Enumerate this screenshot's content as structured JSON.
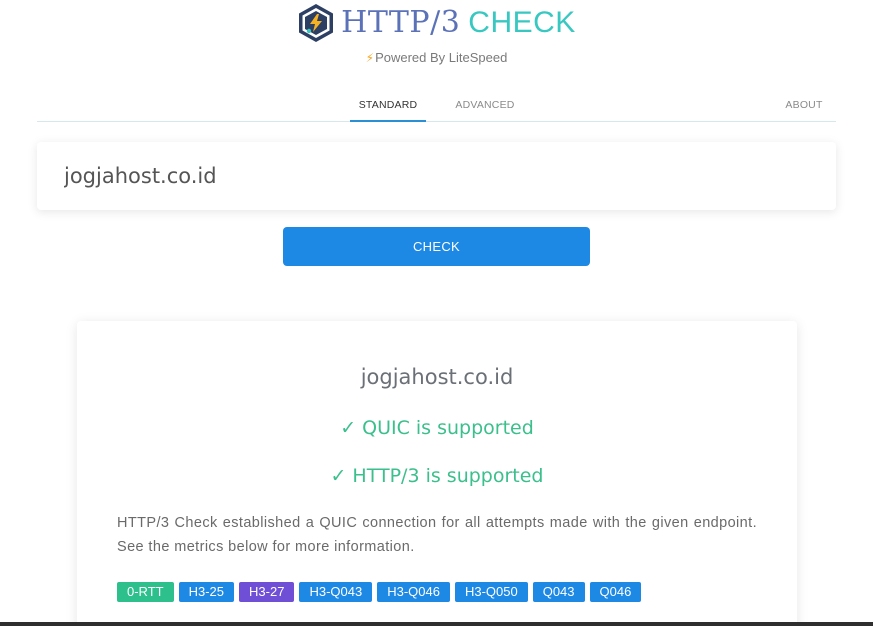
{
  "brand": {
    "title_http": "HTTP/3",
    "title_check": "CHECK",
    "powered_by": "Powered By LiteSpeed",
    "logo_icon": "litespeed-hexagon-logo-icon",
    "bolt_icon": "lightning-bolt-icon",
    "colors": {
      "http": "#5b72b8",
      "check": "#38c7c1",
      "bolt": "#f5a623"
    }
  },
  "tabs": [
    {
      "label": "STANDARD",
      "active": true
    },
    {
      "label": "ADVANCED",
      "active": false
    },
    {
      "label": "ABOUT",
      "active": false
    }
  ],
  "search": {
    "value": "jogjahost.co.id",
    "button_label": "CHECK",
    "button_color": "#1e88e5"
  },
  "result": {
    "domain": "jogjahost.co.id",
    "quic_status": "QUIC is supported",
    "http3_status": "HTTP/3 is supported",
    "check_icon": "checkmark-icon",
    "status_color": "#3bbf8c",
    "description": "HTTP/3 Check established a QUIC connection for all attempts made with the given endpoint. See the metrics below for more information.",
    "tags": [
      {
        "label": "0-RTT",
        "color": "#2dc08d"
      },
      {
        "label": "H3-25",
        "color": "#1e88e5"
      },
      {
        "label": "H3-27",
        "color": "#6f4fd6"
      },
      {
        "label": "H3-Q043",
        "color": "#1e88e5"
      },
      {
        "label": "H3-Q046",
        "color": "#1e88e5"
      },
      {
        "label": "H3-Q050",
        "color": "#1e88e5"
      },
      {
        "label": "Q043",
        "color": "#1e88e5"
      },
      {
        "label": "Q046",
        "color": "#1e88e5"
      }
    ]
  }
}
